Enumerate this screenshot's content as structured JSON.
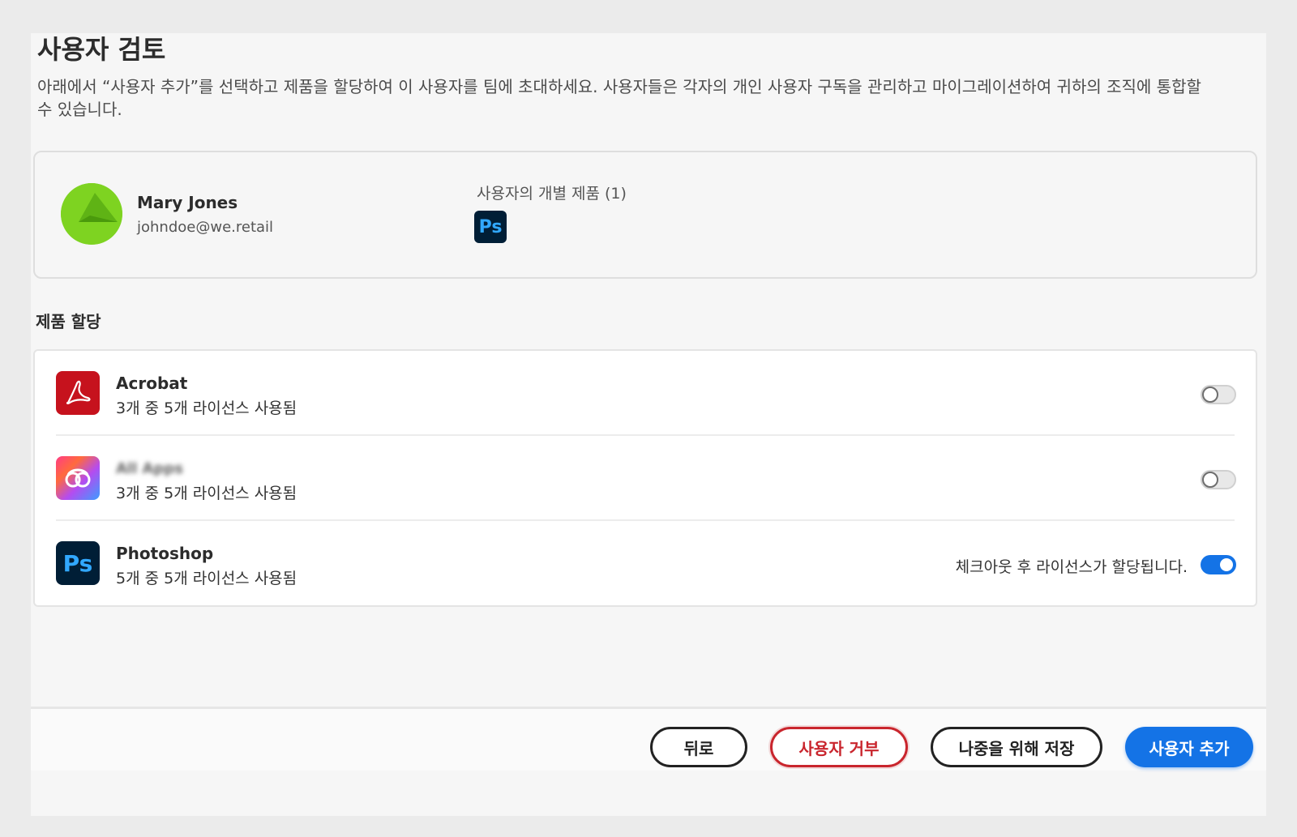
{
  "dialog": {
    "title": "사용자 검토",
    "description": "아래에서 “사용자 추가”를 선택하고 제품을 할당하여 이 사용자를 팀에 초대하세요. 사용자들은 각자의 개인 사용자 구독을 관리하고 마이그레이션하여 귀하의 조직에 통합할 수 있습니다."
  },
  "user": {
    "name": "Mary Jones",
    "email": "johndoe@we.retail",
    "individual_products_label": "사용자의 개별 제품 (1)",
    "individual_products": [
      {
        "icon": "photoshop-icon",
        "abbr": "Ps"
      }
    ],
    "avatar_color": "#7ed321"
  },
  "assignment": {
    "section_title": "제품 할당",
    "products": [
      {
        "name": "Acrobat",
        "usage": "3개 중 5개 라이선스 사용됨",
        "icon": "acrobat-icon",
        "enabled": false,
        "note": ""
      },
      {
        "name": "All Apps",
        "usage": "3개 중 5개 라이선스 사용됨",
        "icon": "creative-cloud-icon",
        "enabled": false,
        "note": ""
      },
      {
        "name": "Photoshop",
        "usage": "5개 중 5개 라이선스 사용됨",
        "icon": "photoshop-icon",
        "abbr": "Ps",
        "enabled": true,
        "note": "체크아웃 후 라이선스가 할당됩니다."
      }
    ]
  },
  "footer": {
    "back_label": "뒤로",
    "reject_label": "사용자 거부",
    "save_label": "나중을 위해 저장",
    "add_label": "사용자 추가"
  },
  "colors": {
    "accent": "#1473e6",
    "danger": "#c9252d",
    "acrobat": "#c6121d",
    "photoshop_bg": "#001e36",
    "photoshop_fg": "#31a8ff"
  }
}
